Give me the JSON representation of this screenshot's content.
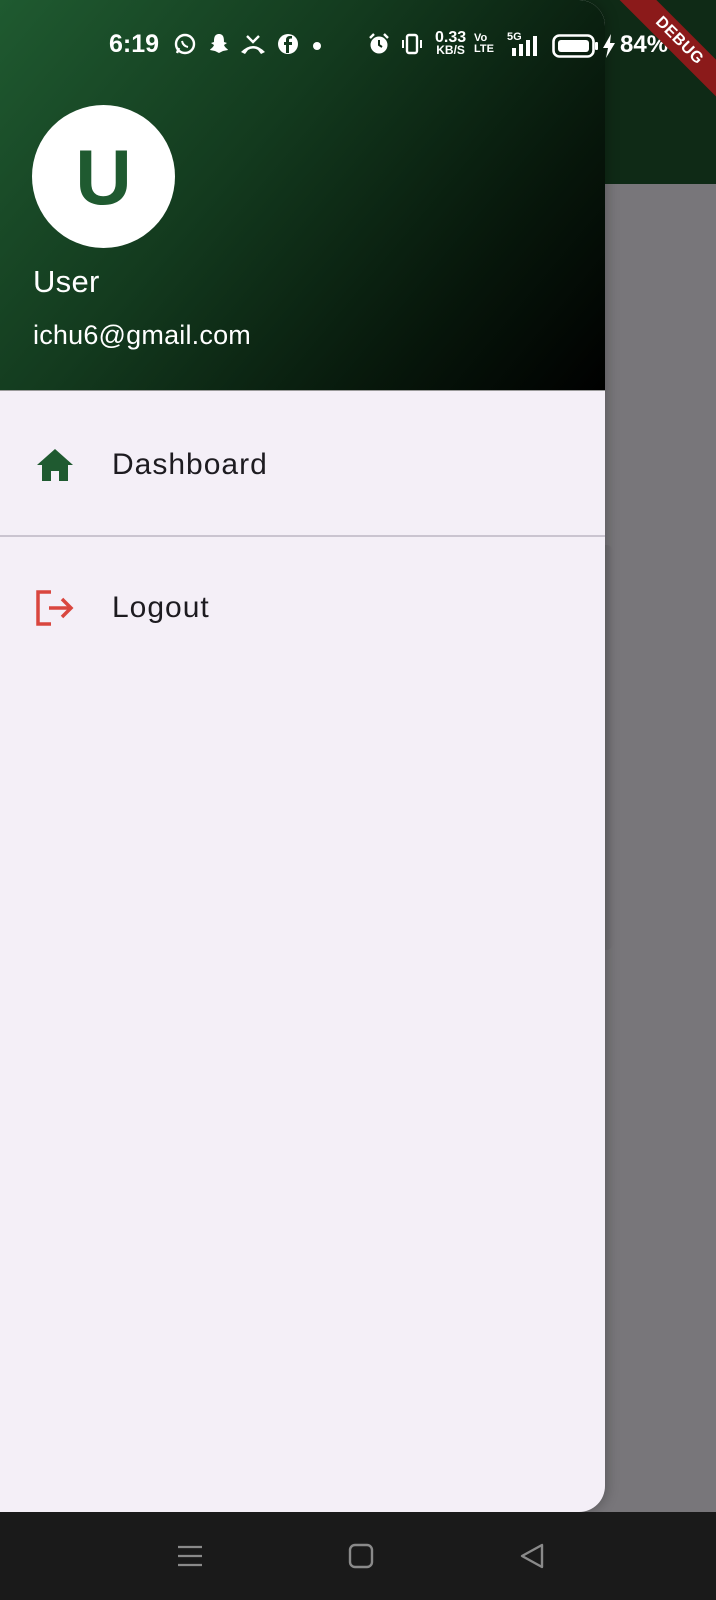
{
  "status_bar": {
    "time": "6:19",
    "network_speed_value": "0.33",
    "network_speed_unit": "KB/S",
    "volte_label": "Vo LTE",
    "network_type": "5G",
    "battery_percent": "84%",
    "icons": [
      "whatsapp-icon",
      "snapchat-icon",
      "missed-call-icon",
      "facebook-icon",
      "dot-icon",
      "alarm-icon",
      "vibrate-icon",
      "signal-icon",
      "battery-icon",
      "charging-icon"
    ]
  },
  "debug_banner": "DEBUG",
  "drawer": {
    "header": {
      "avatar_letter": "U",
      "name": "User",
      "email": "ichu6@gmail.com"
    },
    "items": [
      {
        "label": "Dashboard",
        "icon": "home-icon"
      },
      {
        "label": "Logout",
        "icon": "logout-icon"
      }
    ]
  },
  "navigation_bar": {
    "buttons": [
      "menu-icon",
      "home-square-icon",
      "back-triangle-icon"
    ]
  },
  "colors": {
    "header_gradient_start": "#1f5a30",
    "header_gradient_end": "#000000",
    "drawer_background": "#f4eff7",
    "home_icon": "#1f5a30",
    "logout_icon": "#d9463e",
    "scrim": "#78767a",
    "debug_banner": "#8b1a1a"
  }
}
